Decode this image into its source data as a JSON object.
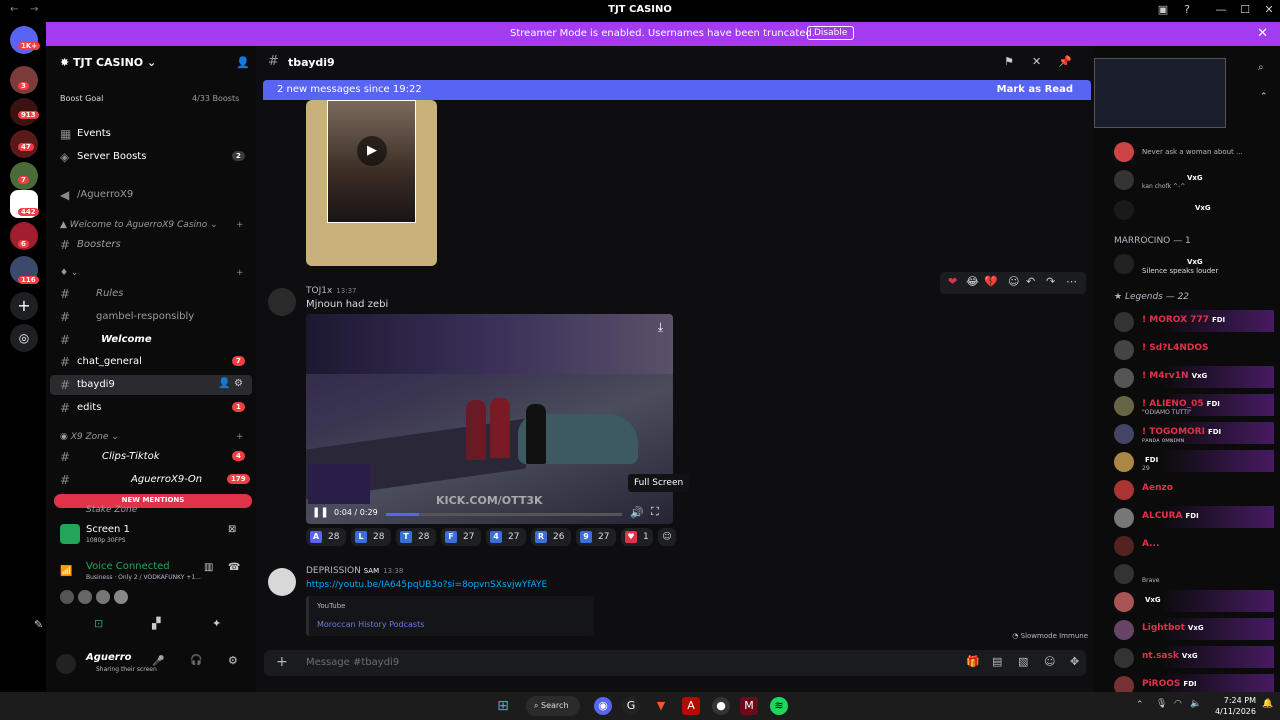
{
  "window": {
    "title": "TJT CASINO"
  },
  "streamer": {
    "message": "Streamer Mode is enabled. Usernames have been truncated.",
    "disable_label": "Disable"
  },
  "rail": {
    "badges": [
      "1K+",
      "3",
      "913",
      "47",
      "7",
      "442",
      "6",
      "116"
    ]
  },
  "sidebar": {
    "server_name": "TJT CASINO",
    "boost_goal": "Boost Goal",
    "boost_count": "4/33 Boosts",
    "events": "Events",
    "server_boosts": "Server Boosts",
    "server_boosts_count": "2",
    "aguerro": "/AguerroX9",
    "welcome_cat": "Welcome to AguerroX9 Casino",
    "boosters": "Boosters",
    "rules": "Rules",
    "gambel": "gambel-responsibly",
    "welcome": "Welcome",
    "chat_general": "chat_general",
    "chat_general_count": "7",
    "tbaydi9": "tbaydi9",
    "edits": "edits",
    "edits_count": "1",
    "x9_zone": "X9 Zone",
    "clips": "Clips-Tiktok",
    "clips_count": "4",
    "aguerro_on": "AguerroX9-On",
    "aguerro_on_count": "179",
    "new_mentions": "NEW MENTIONS",
    "stake_zone": "Stake Zone"
  },
  "screen_share": {
    "title": "Screen 1",
    "sub": "1080p 30FPS"
  },
  "voice": {
    "status": "Voice Connected",
    "channel": "Business · Only 2 / VODKAFUNKY +1..."
  },
  "user": {
    "name": "Aguerro",
    "status": "Sharing their screen"
  },
  "chat": {
    "channel": "tbaydi9",
    "new_messages": "2 new messages since 19:22",
    "mark_read": "Mark as Read",
    "msg1": {
      "author": "TOJ1x",
      "time": "13:37",
      "text": "Mjnoun had zebi"
    },
    "video": {
      "time": "0:04 / 0:29",
      "overlay": "KICK.COM/OTT3K",
      "tooltip": "Full Screen",
      "progress": 0.14
    },
    "reactions": [
      {
        "emo": "A",
        "color": "#5865f2",
        "n": "28"
      },
      {
        "emo": "L",
        "color": "#3b6fd8",
        "n": "28"
      },
      {
        "emo": "T",
        "color": "#3b6fd8",
        "n": "28"
      },
      {
        "emo": "F",
        "color": "#3b6fd8",
        "n": "27"
      },
      {
        "emo": "4",
        "color": "#3b6fd8",
        "n": "27"
      },
      {
        "emo": "R",
        "color": "#3b6fd8",
        "n": "26"
      },
      {
        "emo": "9",
        "color": "#3b6fd8",
        "n": "27"
      },
      {
        "emo": "♥",
        "color": "#e0334a",
        "n": "1"
      }
    ],
    "msg2": {
      "author": "DEPRISSION",
      "tag": "SAM",
      "time": "13:38",
      "link": "https://youtu.be/IA645pqUB3o?si=8opvnSXsvjwYfAYE"
    },
    "embed": {
      "provider": "YouTube",
      "title": "Moroccan History Podcasts"
    },
    "slowmode": "Slowmode Immune",
    "placeholder": "Message #tbaydi9"
  },
  "members": {
    "m1": {
      "sub": "Never ask a woman about ..."
    },
    "m2": {
      "tag": "VxG",
      "sub": "kan chofk ^-^"
    },
    "m3": {
      "tag": "VxG"
    },
    "marrocino": "MARROCINO — 1",
    "m4": {
      "tag": "VxG",
      "sub": "Silence speaks louder"
    },
    "legends": "Legends — 22",
    "list": [
      {
        "name": "! MOROX 777",
        "tag": "FDI",
        "color": "#e0334a"
      },
      {
        "name": "! Sd?L4NDOS",
        "tag": "",
        "color": "#e0334a"
      },
      {
        "name": "! M4rv1N",
        "tag": "VxG",
        "color": "#e0334a"
      },
      {
        "name": "! ALIENO_05",
        "tag": "FDI",
        "color": "#e0334a",
        "sub": "\"ODIAMO TUTTI\""
      },
      {
        "name": "! TOGOMORI",
        "tag": "FDI",
        "color": "#e0334a",
        "sub": "ᴘᴀɴᴅᴀ ᴏᴍɴɪᴍɴ"
      },
      {
        "name": "",
        "tag": "FDI",
        "color": "#e0334a",
        "sub": "29"
      },
      {
        "name": "Aenzo",
        "tag": "",
        "color": "#e0334a"
      },
      {
        "name": "ALCURA",
        "tag": "FDI",
        "color": "#e0334a"
      },
      {
        "name": "A...",
        "tag": "",
        "color": "#e0334a"
      },
      {
        "name": "",
        "tag": "",
        "color": "#e0334a",
        "sub": "Brave"
      },
      {
        "name": "",
        "tag": "VxG",
        "color": "#e0334a"
      },
      {
        "name": "Lightbot",
        "tag": "VxG",
        "color": "#e0334a"
      },
      {
        "name": "nt.sask",
        "tag": "VxG",
        "color": "#e0334a"
      },
      {
        "name": "PiROOS",
        "tag": "FDI",
        "color": "#e0334a"
      }
    ]
  },
  "taskbar": {
    "search": "Search",
    "time": "7:24 PM",
    "date": "4/11/2026"
  }
}
